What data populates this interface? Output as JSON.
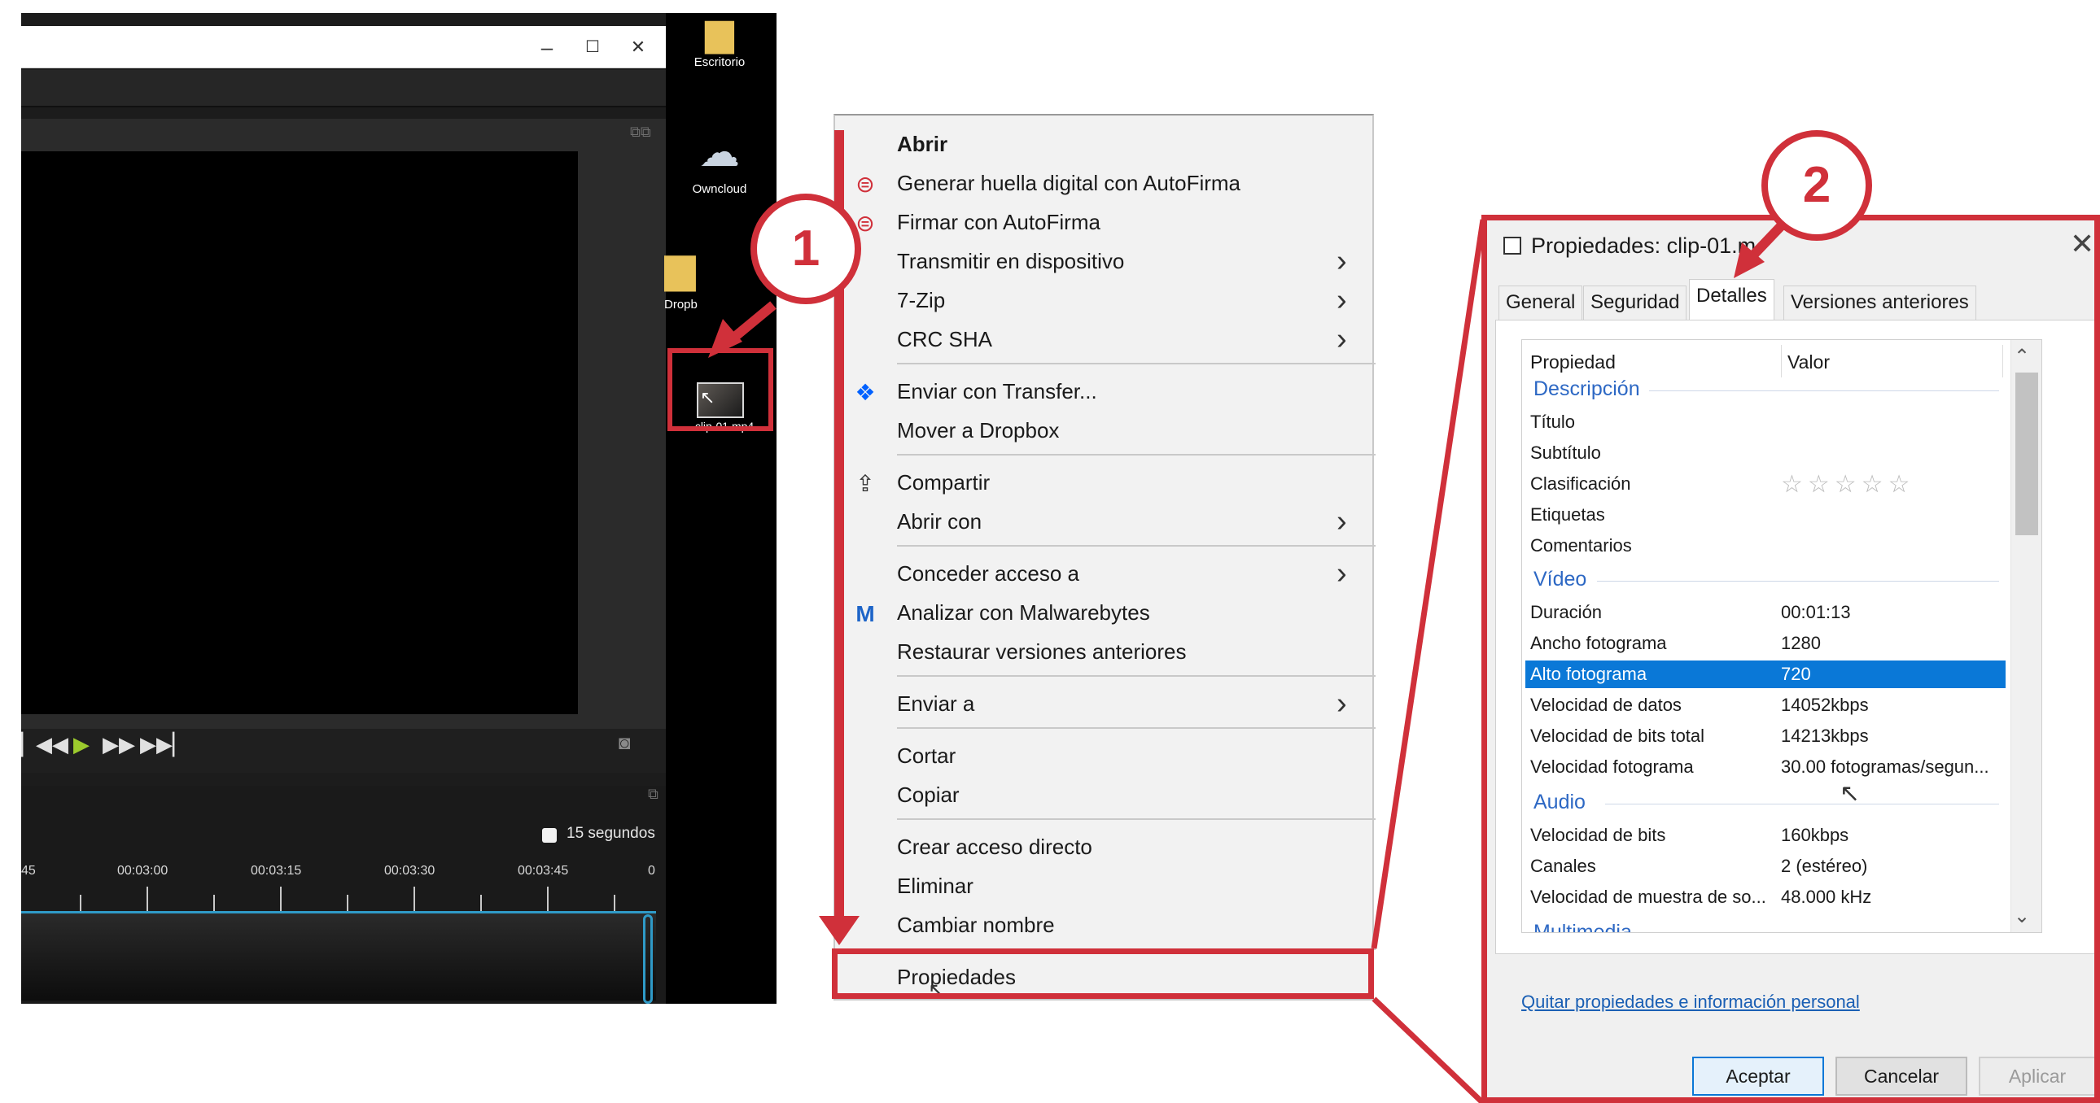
{
  "editor": {
    "window_controls": [
      "–",
      "☐",
      "✕"
    ],
    "segment_label": "15 segundos",
    "ruler_labels": [
      "45",
      "00:03:00",
      "00:03:15",
      "00:03:30",
      "00:03:45",
      "0"
    ]
  },
  "desktop": {
    "icons": [
      {
        "label": "Escritorio",
        "icon": "folder-icon"
      },
      {
        "label": "Owncloud",
        "icon": "cloud-icon"
      },
      {
        "label": "Dropb",
        "icon": "dropbox-folder-icon"
      }
    ],
    "selected_file": "clip-01.mp4"
  },
  "context_menu": {
    "items": [
      {
        "label": "Abrir",
        "bold": true
      },
      {
        "label": "Generar huella digital con AutoFirma",
        "icon": "autofirma-icon"
      },
      {
        "label": "Firmar con AutoFirma",
        "icon": "autofirma-icon"
      },
      {
        "label": "Transmitir en dispositivo",
        "submenu": true
      },
      {
        "label": "7-Zip",
        "submenu": true
      },
      {
        "label": "CRC SHA",
        "submenu": true
      },
      {
        "label": "Enviar con Transfer...",
        "icon": "dropbox-icon"
      },
      {
        "label": "Mover a Dropbox"
      },
      {
        "label": "Compartir",
        "icon": "share-icon"
      },
      {
        "label": "Abrir con",
        "submenu": true
      },
      {
        "label": "Conceder acceso a",
        "submenu": true
      },
      {
        "label": "Analizar con Malwarebytes",
        "icon": "malwarebytes-icon"
      },
      {
        "label": "Restaurar versiones anteriores"
      },
      {
        "label": "Enviar a",
        "submenu": true
      },
      {
        "label": "Cortar"
      },
      {
        "label": "Copiar"
      },
      {
        "label": "Crear acceso directo"
      },
      {
        "label": "Eliminar"
      },
      {
        "label": "Cambiar nombre"
      },
      {
        "label": "Propiedades"
      }
    ]
  },
  "dialog": {
    "title": "Propiedades: clip-01.m",
    "close": "✕",
    "tabs": [
      "General",
      "Seguridad",
      "Detalles",
      "Versiones anteriores"
    ],
    "selected_tab": "Detalles",
    "columns": [
      "Propiedad",
      "Valor"
    ],
    "groups": [
      {
        "name": "Descripción",
        "rows": [
          {
            "prop": "Título",
            "value": ""
          },
          {
            "prop": "Subtítulo",
            "value": ""
          },
          {
            "prop": "Clasificación",
            "value": "☆☆☆☆☆"
          },
          {
            "prop": "Etiquetas",
            "value": ""
          },
          {
            "prop": "Comentarios",
            "value": ""
          }
        ]
      },
      {
        "name": "Vídeo",
        "rows": [
          {
            "prop": "Duración",
            "value": "00:01:13"
          },
          {
            "prop": "Ancho fotograma",
            "value": "1280"
          },
          {
            "prop": "Alto fotograma",
            "value": "720"
          },
          {
            "prop": "Velocidad de datos",
            "value": "14052kbps"
          },
          {
            "prop": "Velocidad de bits total",
            "value": "14213kbps"
          },
          {
            "prop": "Velocidad fotograma",
            "value": "30.00 fotogramas/segun..."
          }
        ]
      },
      {
        "name": "Audio",
        "rows": [
          {
            "prop": "Velocidad de bits",
            "value": "160kbps"
          },
          {
            "prop": "Canales",
            "value": "2 (estéreo)"
          },
          {
            "prop": "Velocidad de muestra de so...",
            "value": "48.000 kHz"
          }
        ]
      },
      {
        "name": "Multimedia",
        "rows": []
      }
    ],
    "selected_row": "Alto fotograma",
    "remove_link": "Quitar propiedades e información personal",
    "buttons": {
      "ok": "Aceptar",
      "cancel": "Cancelar",
      "apply": "Aplicar"
    }
  },
  "callouts": [
    "1",
    "2"
  ],
  "colors": {
    "highlight": "#d0303a",
    "selection": "#0a78d7",
    "group_header": "#2d68c4"
  }
}
